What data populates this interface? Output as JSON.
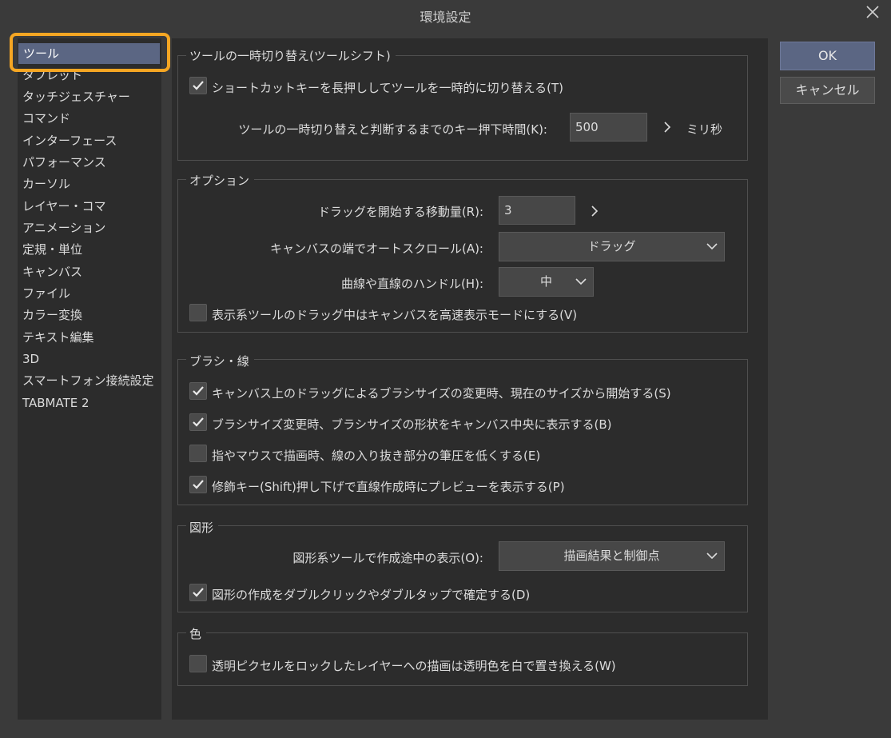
{
  "window": {
    "title": "環境設定"
  },
  "sidebar": {
    "items": [
      {
        "label": "ツール"
      },
      {
        "label": "タブレット"
      },
      {
        "label": "タッチジェスチャー"
      },
      {
        "label": "コマンド"
      },
      {
        "label": "インターフェース"
      },
      {
        "label": "パフォーマンス"
      },
      {
        "label": "カーソル"
      },
      {
        "label": "レイヤー・コマ"
      },
      {
        "label": "アニメーション"
      },
      {
        "label": "定規・単位"
      },
      {
        "label": "キャンバス"
      },
      {
        "label": "ファイル"
      },
      {
        "label": "カラー変換"
      },
      {
        "label": "テキスト編集"
      },
      {
        "label": "3D"
      },
      {
        "label": "スマートフォン接続設定"
      },
      {
        "label": "TABMATE 2"
      }
    ]
  },
  "buttons": {
    "ok": "OK",
    "cancel": "キャンセル"
  },
  "tool_shift": {
    "title": "ツールの一時切り替え(ツールシフト)",
    "toggle_label": "ショートカットキーを長押ししてツールを一時的に切り替える(T)",
    "toggle_checked": true,
    "delay_label": "ツールの一時切り替えと判断するまでのキー押下時間(K):",
    "delay_value": "500",
    "delay_unit": "ミリ秒"
  },
  "options": {
    "title": "オプション",
    "drag_label": "ドラッグを開始する移動量(R):",
    "drag_value": "3",
    "autoscroll_label": "キャンバスの端でオートスクロール(A):",
    "autoscroll_value": "ドラッグ",
    "handle_label": "曲線や直線のハンドル(H):",
    "handle_value": "中",
    "fast_display_label": "表示系ツールのドラッグ中はキャンバスを高速表示モードにする(V)",
    "fast_display_checked": false
  },
  "brush": {
    "title": "ブラシ・線",
    "items": [
      {
        "label": "キャンバス上のドラッグによるブラシサイズの変更時、現在のサイズから開始する(S)",
        "checked": true
      },
      {
        "label": "ブラシサイズ変更時、ブラシサイズの形状をキャンバス中央に表示する(B)",
        "checked": true
      },
      {
        "label": "指やマウスで描画時、線の入り抜き部分の筆圧を低くする(E)",
        "checked": false
      },
      {
        "label": "修飾キー(Shift)押し下げで直線作成時にプレビューを表示する(P)",
        "checked": true
      }
    ]
  },
  "figure": {
    "title": "図形",
    "display_label": "図形系ツールで作成途中の表示(O):",
    "display_value": "描画結果と制御点",
    "doubleclick_label": "図形の作成をダブルクリックやダブルタップで確定する(D)",
    "doubleclick_checked": true
  },
  "color": {
    "title": "色",
    "replace_label": "透明ピクセルをロックしたレイヤーへの描画は透明色を白で置き換える(W)",
    "replace_checked": false
  },
  "colors": {
    "accent": "#5b6683",
    "highlight": "#f5a623"
  },
  "icons": {
    "close": "close-icon",
    "check": "check-icon",
    "chevron_down": "chevron-down-icon",
    "chevron_right": "chevron-right-icon"
  }
}
